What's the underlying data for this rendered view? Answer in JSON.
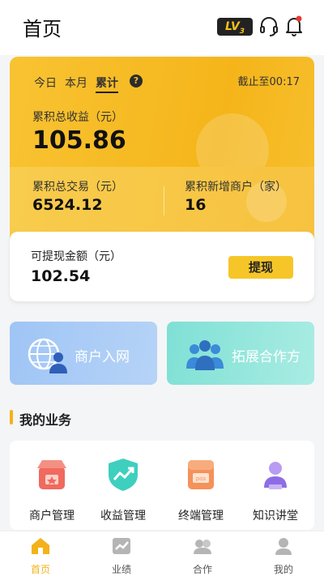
{
  "header": {
    "title": "首页",
    "level_badge": "LV",
    "level_number": "3",
    "icons": [
      "headset-icon",
      "bell-icon"
    ]
  },
  "earnings_card": {
    "tabs": [
      {
        "label": "今日",
        "active": false
      },
      {
        "label": "本月",
        "active": false
      },
      {
        "label": "累计",
        "active": true
      }
    ],
    "cutoff": "截止至00:17",
    "total_income_label": "累积总收益（元）",
    "total_income_value": "105.86",
    "total_trade_label": "累积总交易（元）",
    "total_trade_value": "6524.12",
    "new_merchants_label": "累积新增商户（家）",
    "new_merchants_value": "16"
  },
  "withdraw": {
    "label": "可提现金额（元）",
    "value": "102.54",
    "button_label": "提现"
  },
  "banners": {
    "merchant_label": "商户入网",
    "partner_label": "拓展合作方"
  },
  "business": {
    "title": "我的业务",
    "items": [
      {
        "label": "商户管理",
        "icon": "merchant-shop-icon"
      },
      {
        "label": "收益管理",
        "icon": "income-shield-icon"
      },
      {
        "label": "终端管理",
        "icon": "pos-terminal-icon"
      },
      {
        "label": "知识讲堂",
        "icon": "lecture-icon"
      }
    ]
  },
  "tabbar": {
    "items": [
      {
        "label": "首页",
        "active": true
      },
      {
        "label": "业绩",
        "active": false
      },
      {
        "label": "合作",
        "active": false
      },
      {
        "label": "我的",
        "active": false
      }
    ]
  },
  "colors": {
    "accent": "#f3b21a",
    "card_yellow": "#f6be2c",
    "merchant_banner": "#a9ccf6",
    "partner_banner": "#8fe5da"
  }
}
